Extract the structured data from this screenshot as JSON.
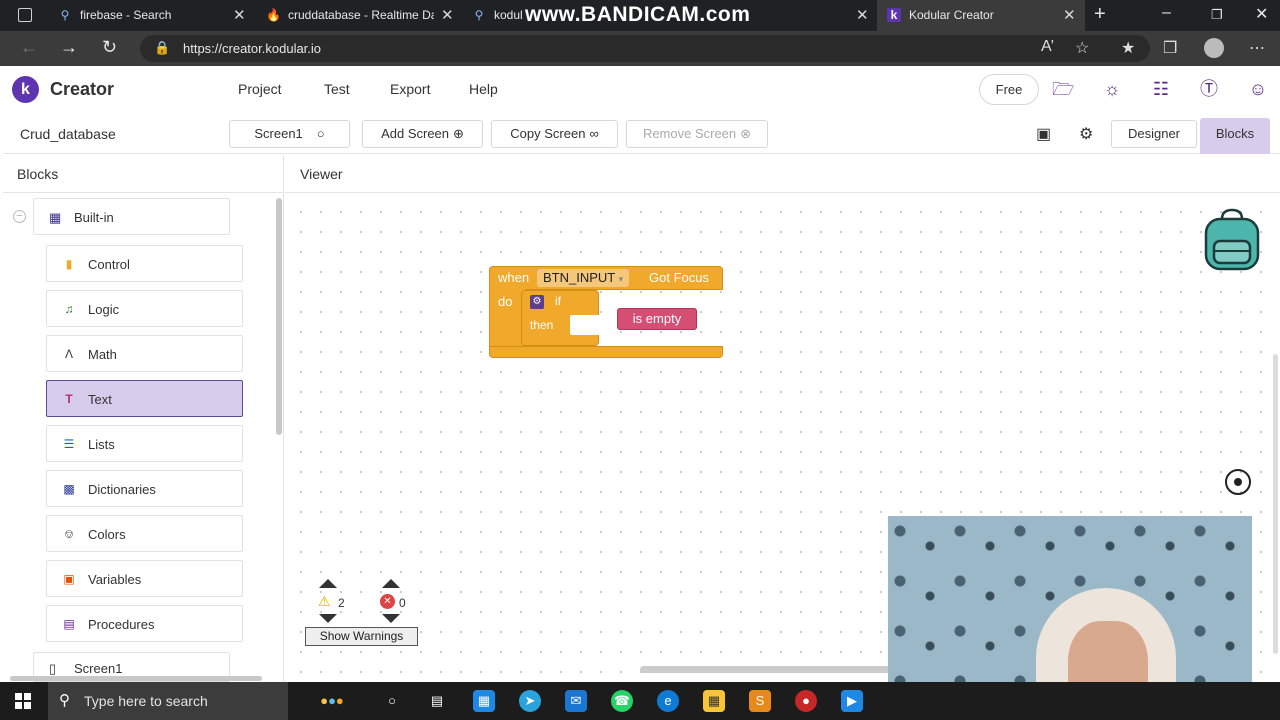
{
  "browser": {
    "tabs": [
      {
        "title": "firebase - Search",
        "icon": "search-icon"
      },
      {
        "title": "cruddatabase - Realtime Data",
        "icon": "firebase-icon"
      },
      {
        "title": "kodul",
        "icon": "search-icon"
      },
      {
        "title": "Kodular Creator",
        "icon": "kodular-icon",
        "active": true
      }
    ],
    "watermark": "www.BANDICAM.com",
    "url": "https://creator.kodular.io"
  },
  "app": {
    "brand": "Creator",
    "logo_letter": "k",
    "menu": [
      "Project",
      "Test",
      "Export",
      "Help"
    ],
    "free_label": "Free",
    "project_name": "Crud_database",
    "screen_select": "Screen1",
    "add_screen": "Add Screen",
    "copy_screen": "Copy Screen",
    "remove_screen": "Remove Screen",
    "designer": "Designer",
    "blocks": "Blocks"
  },
  "blocks_panel": {
    "title": "Blocks",
    "builtin": "Built-in",
    "categories": [
      {
        "label": "Control",
        "icon": "control-icon",
        "color": "#f0a92a"
      },
      {
        "label": "Logic",
        "icon": "logic-icon",
        "color": "#2e7d32"
      },
      {
        "label": "Math",
        "icon": "math-icon",
        "color": "#333333"
      },
      {
        "label": "Text",
        "icon": "text-icon",
        "color": "#b0306a",
        "selected": true
      },
      {
        "label": "Lists",
        "icon": "lists-icon",
        "color": "#1565c0"
      },
      {
        "label": "Dictionaries",
        "icon": "dictionaries-icon",
        "color": "#283593"
      },
      {
        "label": "Colors",
        "icon": "colors-icon",
        "color": "#555555"
      },
      {
        "label": "Variables",
        "icon": "variables-icon",
        "color": "#e65100"
      },
      {
        "label": "Procedures",
        "icon": "procedures-icon",
        "color": "#6a1b9a"
      }
    ],
    "screen1": "Screen1"
  },
  "viewer": {
    "title": "Viewer",
    "event_block": {
      "when": "when",
      "component": "BTN_INPUT",
      "event": "Got Focus",
      "do": "do",
      "if": "if",
      "then": "then",
      "is_empty": "is empty"
    },
    "warnings_count": "2",
    "errors_count": "0",
    "show_warnings": "Show Warnings"
  },
  "taskbar": {
    "search_placeholder": "Type here to search"
  }
}
